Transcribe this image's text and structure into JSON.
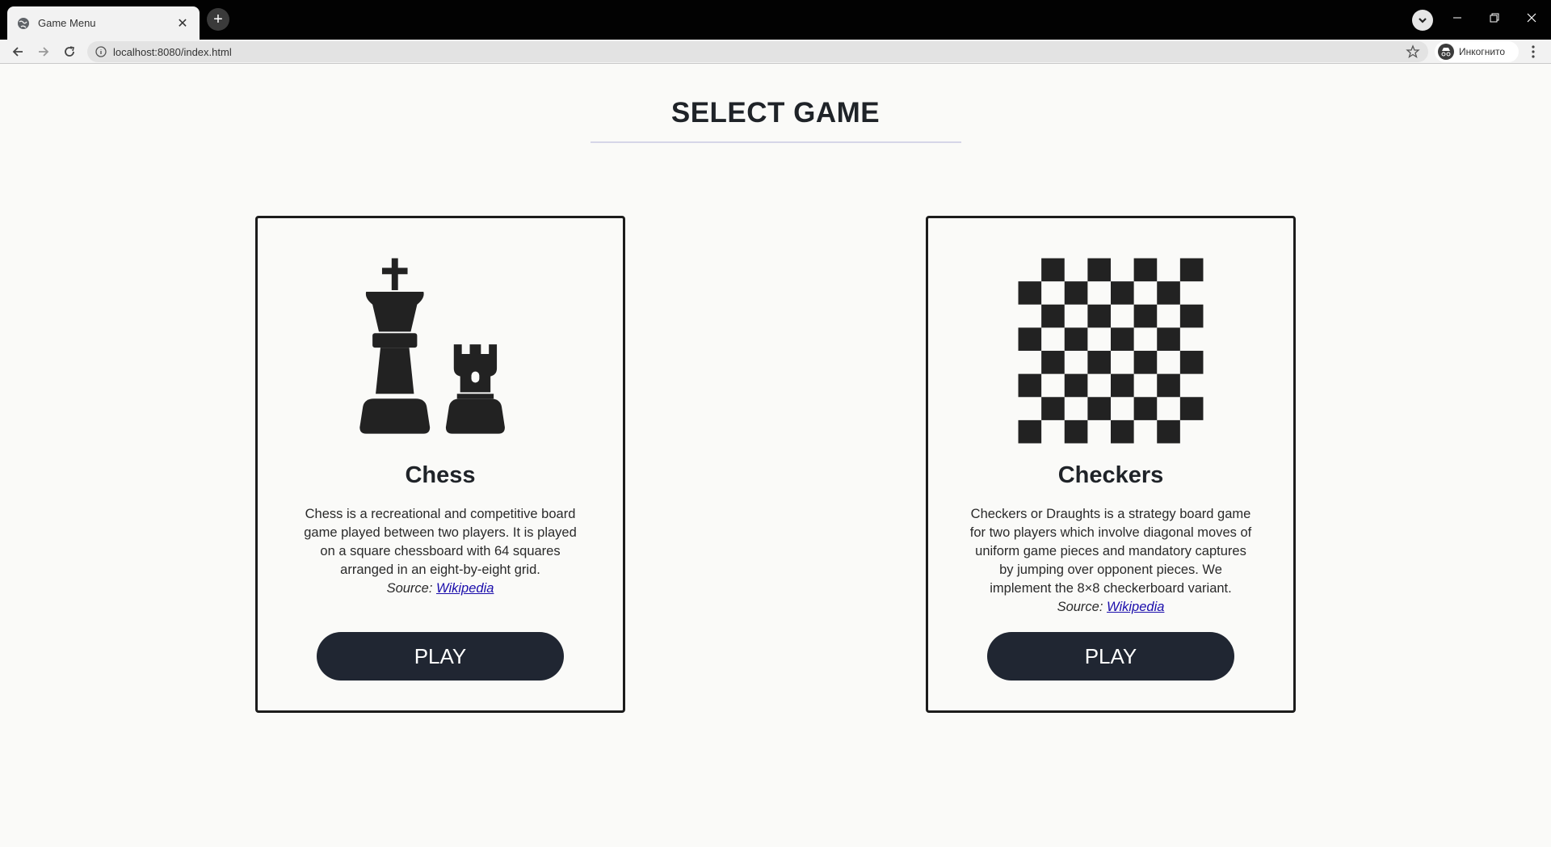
{
  "browser": {
    "tab_title": "Game Menu",
    "url": "localhost:8080/index.html",
    "incognito_label": "Инкогнито"
  },
  "page": {
    "title": "SELECT GAME"
  },
  "games": [
    {
      "name": "Chess",
      "description": "Chess is a recreational and competitive board game played between two players. It is played on a square chessboard with 64 squares arranged in an eight-by-eight grid.",
      "source_label": "Source:",
      "source_link": "Wikipedia",
      "play_label": "PLAY",
      "icon": "chess-king-rook-icon"
    },
    {
      "name": "Checkers",
      "description": "Checkers or Draughts is a strategy board game for two players which involve diagonal moves of uniform game pieces and mandatory captures by jumping over opponent pieces. We implement the 8×8 checkerboard variant.",
      "source_label": "Source:",
      "source_link": "Wikipedia",
      "play_label": "PLAY",
      "icon": "checkerboard-icon"
    }
  ],
  "colors": {
    "page_bg": "#fafaf8",
    "button_bg": "#202632",
    "link": "#1a0dab",
    "border": "#1c1c1c"
  }
}
